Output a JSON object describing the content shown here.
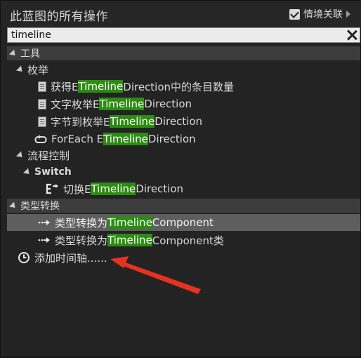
{
  "window": {
    "title": "此蓝图的所有操作"
  },
  "context": {
    "label": "情境关联",
    "checked": true
  },
  "search": {
    "value": "timeline"
  },
  "tree": {
    "tools": "工具",
    "enum": "枚举",
    "items_enum": [
      {
        "pre": "获得E",
        "hl": "Timeline",
        "post": "Direction中的条目数量"
      },
      {
        "pre": "文字枚举E",
        "hl": "Timeline",
        "post": "Direction"
      },
      {
        "pre": "字节到枚举E",
        "hl": "Timeline",
        "post": "Direction"
      },
      {
        "pre": "ForEach E",
        "hl": "Timeline",
        "post": "Direction"
      }
    ],
    "flow": "流程控制",
    "switch": "Switch",
    "switch_item": {
      "pre": "切换E",
      "hl": "Timeline",
      "post": "Direction"
    },
    "cast": "类型转换",
    "items_cast": [
      {
        "pre": "类型转换为 ",
        "hl": "Timeline",
        "post": "Component"
      },
      {
        "pre": "类型转换为 ",
        "hl": "Timeline",
        "post": "Component类"
      }
    ],
    "add_timeline": "添加时间轴......"
  },
  "colors": {
    "highlight": "#2c8b12",
    "arrow": "#e53222"
  }
}
